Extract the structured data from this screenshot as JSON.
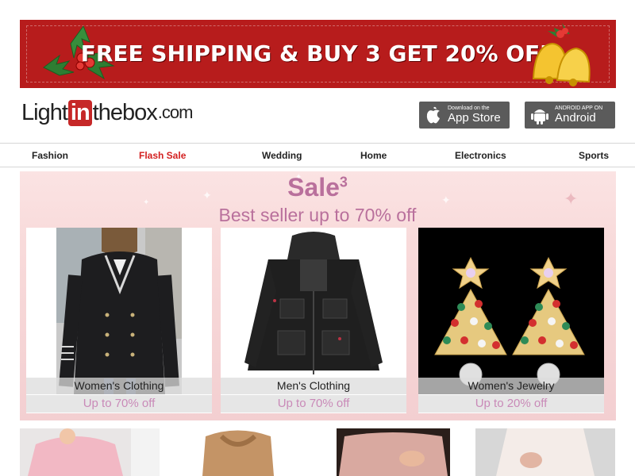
{
  "banner": {
    "text": "FREE SHIPPING & BUY 3 GET 20% OFF"
  },
  "header": {
    "logo": {
      "part1": "Light",
      "part2": "in",
      "part3": "thebox",
      "part4": ".com"
    },
    "app_store": {
      "small": "Download on the",
      "big": "App Store"
    },
    "android": {
      "small": "ANDROID APP ON",
      "big": "Android"
    }
  },
  "nav": {
    "items": [
      {
        "label": "Fashion"
      },
      {
        "label": "Flash Sale"
      },
      {
        "label": "Wedding"
      },
      {
        "label": "Home"
      },
      {
        "label": "Electronics"
      },
      {
        "label": "Sports"
      }
    ]
  },
  "sale": {
    "title": "Sale",
    "title_sup": "3",
    "subtitle": "Best seller up to 70% off"
  },
  "products": [
    {
      "label": "Women's Clothing",
      "deal": "Up to 70% off"
    },
    {
      "label": "Men's Clothing",
      "deal": "Up to 70% off"
    },
    {
      "label": "Women's Jewelry",
      "deal": "Up to 20% off"
    }
  ],
  "colors": {
    "banner_red": "#b71c1c",
    "flash_sale_red": "#d32020",
    "sale_pink": "#b9709c",
    "deal_pink": "#c98ab8",
    "app_button_gray": "#5b5b5b"
  }
}
